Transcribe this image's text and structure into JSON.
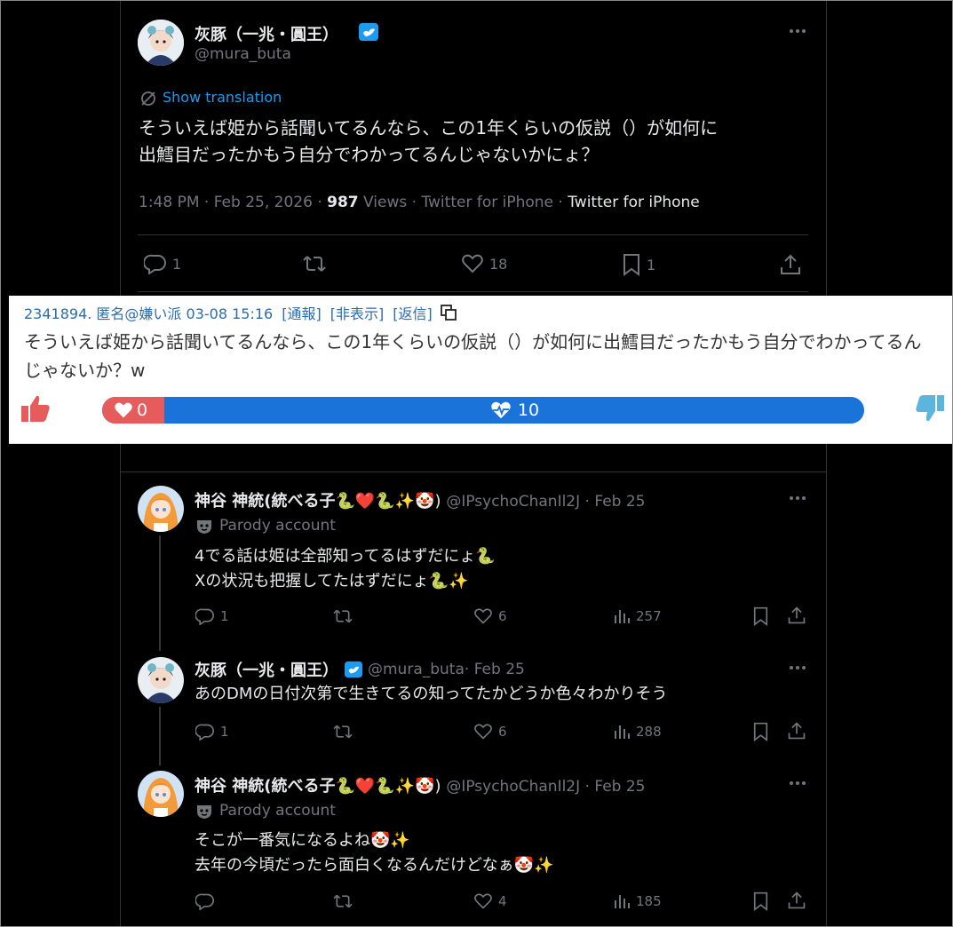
{
  "main_tweet": {
    "display_name": "灰豚（一兆・圓王）",
    "handle": "@mura_buta",
    "show_translation": "Show translation",
    "text_line1": "そういえば姫から話聞いてるんなら、この1年くらいの仮説（）が如何に",
    "text_line2": "出鱈目だったかもう自分でわかってるんじゃないかにょ？",
    "time": "1:48 PM · Feb 25, 2026 · ",
    "views_count": "987",
    "views_label": " Views · Twitter for iPhone · ",
    "source": "Twitter for iPhone",
    "replies": "1",
    "likes": "18",
    "bookmarks": "1"
  },
  "bbs_post": {
    "header": "2341894. 匿名@嫌い派 03-08 15:16",
    "report": "[通報]",
    "hide": "[非表示]",
    "reply": "[返信]",
    "body": "そういえば姫から話聞いてるんなら、この1年くらいの仮説（）が如何に出鱈目だったかもう自分でわかってるんじゃないか？w",
    "like_count": "0",
    "total_count": "10",
    "like_fraction": 0.0,
    "colors": {
      "like": "#e65c5c",
      "total": "#1a73d9",
      "thumb_up": "#e65c5c",
      "thumb_down": "#5bb5dc"
    }
  },
  "replies": [
    {
      "display_name": "神谷 神統(統べる子",
      "emoji_tail": "🐍❤️🐍✨🤡)",
      "handle": "@IPsychoChanIl2J",
      "date": " · Feb 25",
      "parody": "Parody account",
      "line1": "4でる話は姫は全部知ってるはずだにょ🐍",
      "line2": "Xの状況も把握してたはずだにょ🐍✨",
      "replies": "1",
      "retweets": "",
      "likes": "6",
      "views": "257"
    },
    {
      "display_name": "灰豚（一兆・圓王）",
      "handle": "@mura_buta",
      "date": " · Feb 25",
      "line1": "あのDMの日付次第で生きてるの知ってたかどうか色々わかりそう",
      "replies": "1",
      "retweets": "",
      "likes": "6",
      "views": "288"
    },
    {
      "display_name": "神谷 神統(統べる子",
      "emoji_tail": "🐍❤️🐍✨🤡)",
      "handle": "@IPsychoChanIl2J",
      "date": " · Feb 25",
      "parody": "Parody account",
      "line1": "そこが一番気になるよね🤡✨",
      "line2": "去年の今頃だったら面白くなるんだけどなぁ🤡✨",
      "replies": "",
      "retweets": "",
      "likes": "4",
      "views": "185"
    }
  ],
  "icons": [
    "more-icon",
    "verified-icon",
    "translate-icon",
    "reply-icon",
    "retweet-icon",
    "like-icon",
    "bookmark-icon",
    "share-icon",
    "views-icon",
    "parody-mask-icon",
    "copy-icon",
    "thumbs-up-icon",
    "thumbs-down-icon",
    "heart-icon",
    "heartbeat-icon"
  ]
}
